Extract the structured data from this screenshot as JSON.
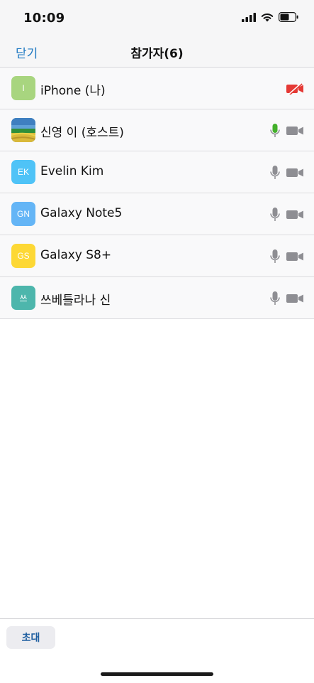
{
  "status": {
    "time": "10:09"
  },
  "nav": {
    "close_label": "닫기",
    "title": "참가자(6)"
  },
  "participants": [
    {
      "initials": "I",
      "name": "iPhone (나)",
      "avatar_color": "#a8d57f",
      "mic": "hidden",
      "camera": "off"
    },
    {
      "initials": "",
      "name": "신영 이 (호스트)",
      "avatar_color": "#4a8ab6",
      "mic": "active",
      "camera": "on"
    },
    {
      "initials": "EK",
      "name": "Evelin Kim",
      "avatar_color": "#4fc3f7",
      "mic": "on",
      "camera": "on"
    },
    {
      "initials": "GN",
      "name": "Galaxy Note5",
      "avatar_color": "#64b5f6",
      "mic": "on",
      "camera": "on"
    },
    {
      "initials": "GS",
      "name": "Galaxy S8+",
      "avatar_color": "#fdd835",
      "mic": "on",
      "camera": "on"
    },
    {
      "initials": "쓰",
      "name": "쓰베틀라나 신",
      "avatar_color": "#4db6ac",
      "mic": "on",
      "camera": "on"
    }
  ],
  "footer": {
    "invite_label": "초대"
  },
  "colors": {
    "accent": "#1f79c2",
    "mic_active": "#43b02a",
    "camera_off": "#e53935",
    "icon_gray": "#8e8e93"
  }
}
